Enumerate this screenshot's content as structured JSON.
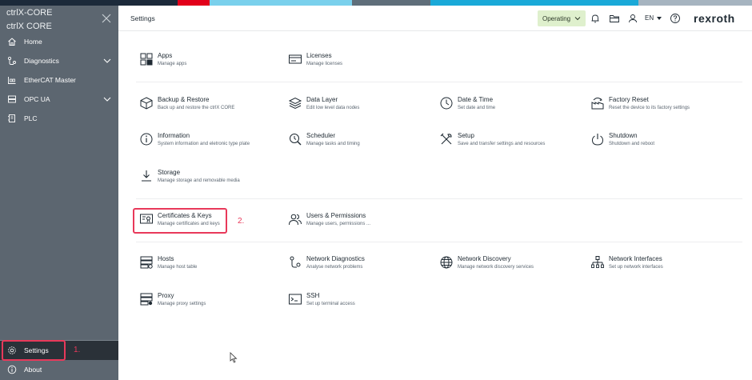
{
  "colors": {
    "sidebar_bg": "#5c6670",
    "sidebar_active": "#2a3138",
    "highlight": "#e8395a",
    "state_bg": "#dff0cd",
    "brand_stripes": [
      "#1c2a3a",
      "#e2001a",
      "#7ad0ec",
      "#5f6e7a",
      "#1aa9d8",
      "#a6b4c0"
    ]
  },
  "sidebar": {
    "app_name_line1": "ctrlX-CORE",
    "app_name_line2": "ctrlX CORE",
    "items": [
      {
        "label": "Home",
        "icon": "home-icon"
      },
      {
        "label": "Diagnostics",
        "icon": "diagnostics-icon",
        "expandable": true
      },
      {
        "label": "EtherCAT Master",
        "icon": "ethercat-icon"
      },
      {
        "label": "OPC UA",
        "icon": "opcua-icon",
        "expandable": true
      },
      {
        "label": "PLC",
        "icon": "plc-icon"
      }
    ],
    "bottom_items": [
      {
        "label": "Settings",
        "icon": "gear-icon",
        "active": true
      },
      {
        "label": "About",
        "icon": "info-icon"
      }
    ]
  },
  "header": {
    "title": "Settings",
    "state_label": "Operating",
    "language": "EN",
    "brand": "rexroth"
  },
  "annotations": {
    "step1": "1.",
    "step2": "2."
  },
  "tiles": [
    {
      "name": "Apps",
      "desc": "Manage apps",
      "icon": "apps-icon"
    },
    {
      "name": "Licenses",
      "desc": "Manage licenses",
      "icon": "licenses-icon"
    },
    {
      "name": "Backup & Restore",
      "desc": "Back up and restore the ctrlX CORE",
      "icon": "backup-icon"
    },
    {
      "name": "Data Layer",
      "desc": "Edit low level data nodes",
      "icon": "data-layer-icon"
    },
    {
      "name": "Date & Time",
      "desc": "Set date and time",
      "icon": "clock-icon"
    },
    {
      "name": "Factory Reset",
      "desc": "Reset the device to its factory settings",
      "icon": "factory-reset-icon"
    },
    {
      "name": "Information",
      "desc": "System information and eletronic type plate",
      "icon": "info-circle-icon"
    },
    {
      "name": "Scheduler",
      "desc": "Manage tasks and timing",
      "icon": "scheduler-icon"
    },
    {
      "name": "Setup",
      "desc": "Save and transfer settings and resources",
      "icon": "setup-icon"
    },
    {
      "name": "Shutdown",
      "desc": "Shutdown and reboot",
      "icon": "power-icon"
    },
    {
      "name": "Storage",
      "desc": "Manage storage and removable media",
      "icon": "storage-icon"
    },
    {
      "name": "Certificates & Keys",
      "desc": "Manage certificates and keys",
      "icon": "certificate-icon"
    },
    {
      "name": "Users & Permissions",
      "desc": "Manage users, permissions ...",
      "icon": "users-icon"
    },
    {
      "name": "Hosts",
      "desc": "Manage host table",
      "icon": "hosts-icon"
    },
    {
      "name": "Network Diagnostics",
      "desc": "Analyse network problems",
      "icon": "network-diagnostics-icon"
    },
    {
      "name": "Network Discovery",
      "desc": "Manage network discovery services",
      "icon": "globe-icon"
    },
    {
      "name": "Network Interfaces",
      "desc": "Set up network interfaces",
      "icon": "network-interfaces-icon"
    },
    {
      "name": "Proxy",
      "desc": "Manage proxy settings",
      "icon": "proxy-icon"
    },
    {
      "name": "SSH",
      "desc": "Set up terminal access",
      "icon": "terminal-icon"
    }
  ]
}
